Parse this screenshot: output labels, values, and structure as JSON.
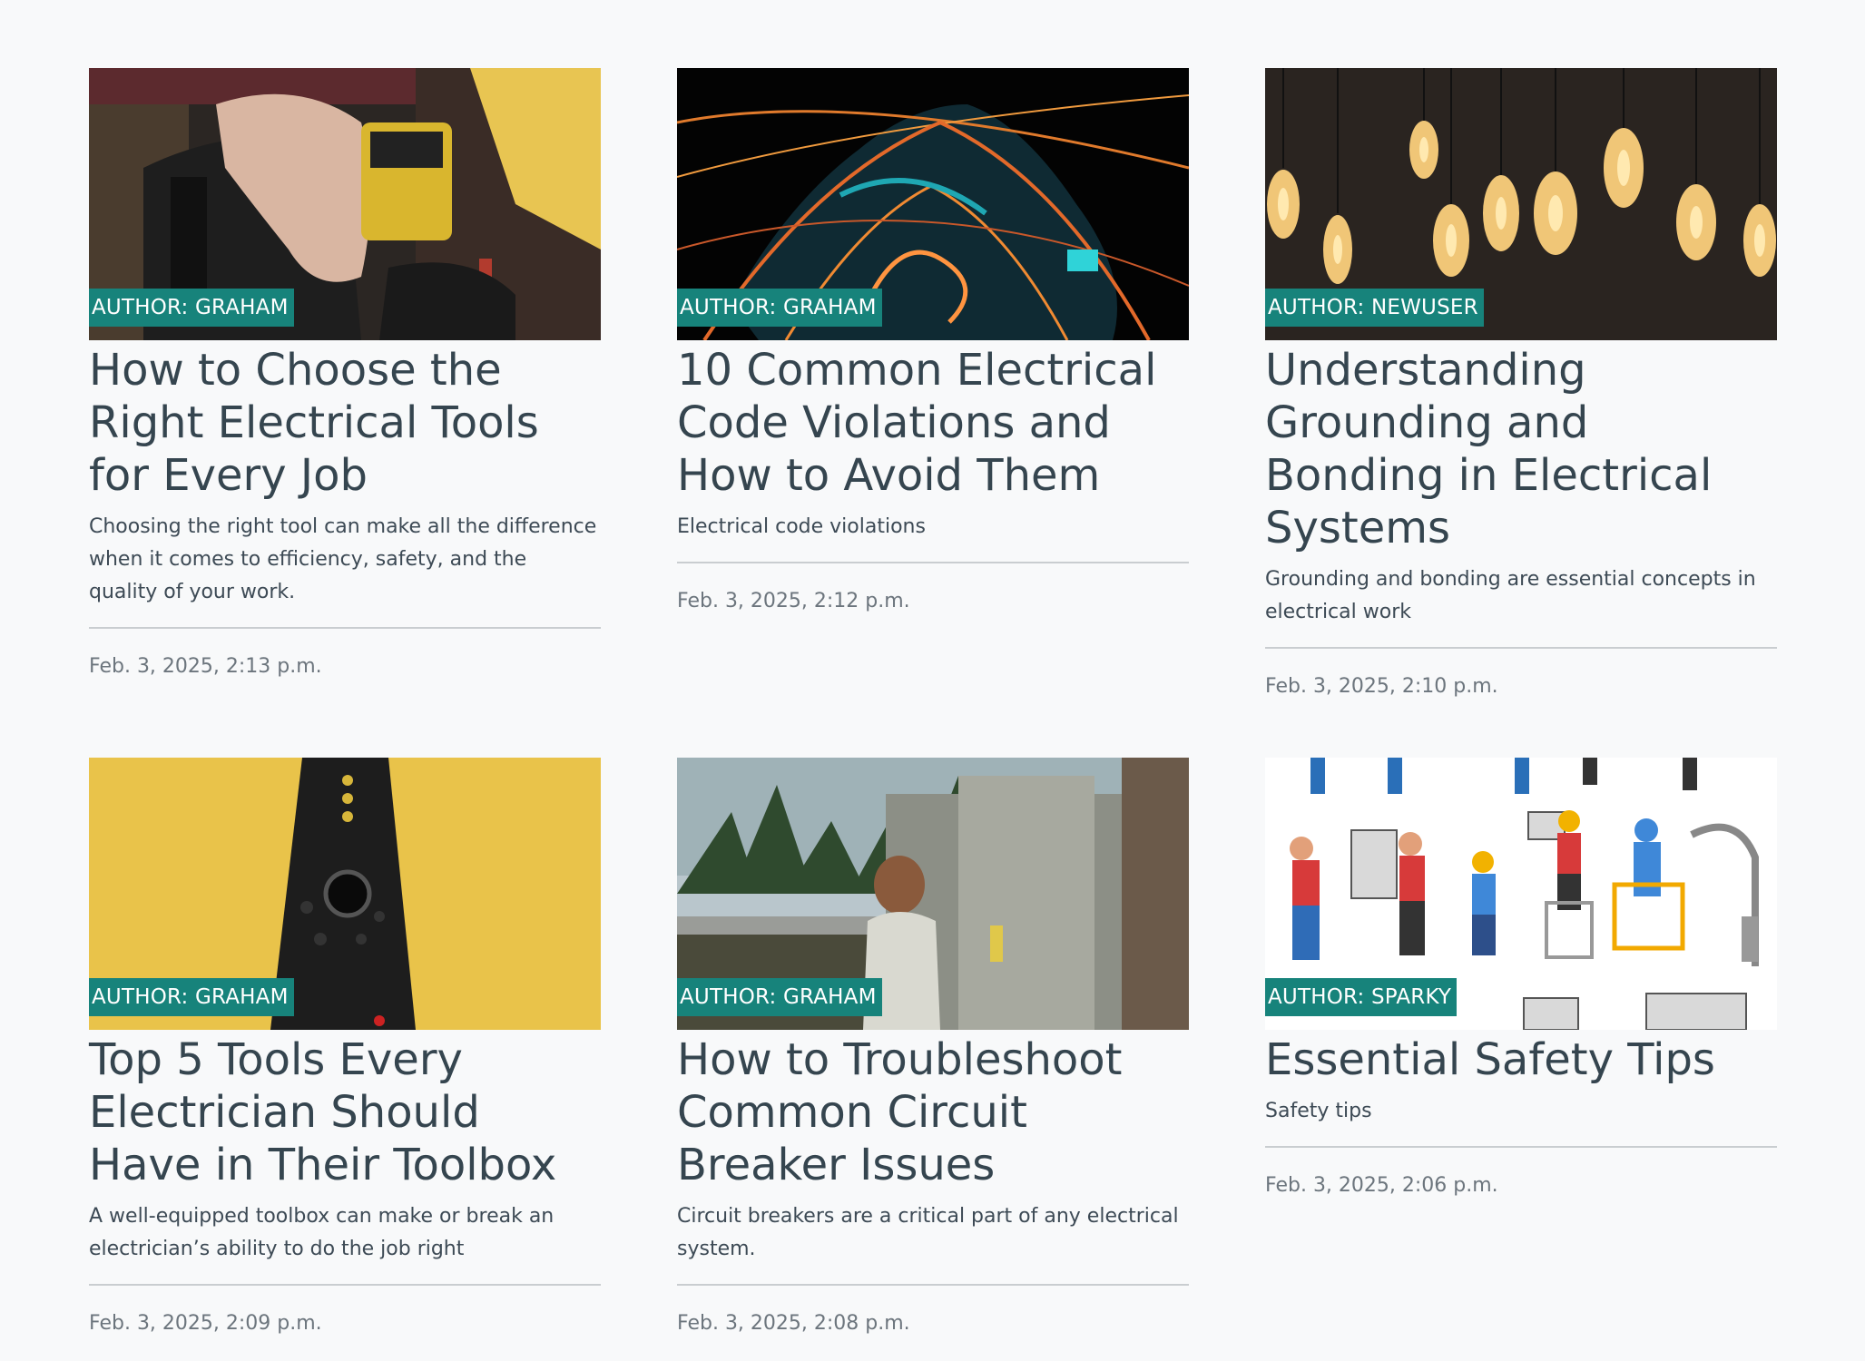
{
  "posts": [
    {
      "image": "electrician-tool-belt-photo",
      "author_label": "AUTHOR: GRAHAM",
      "title": "How to Choose the Right Electrical Tools for Every Job",
      "excerpt": "Choosing the right tool can make all the difference when it comes to efficiency, safety, and the quality of your work.",
      "date": "Feb. 3, 2025, 2:13 p.m."
    },
    {
      "image": "glowing-light-trails-photo",
      "author_label": "AUTHOR: GRAHAM",
      "title": "10 Common Electrical Code Violations and How to Avoid Them",
      "excerpt": "Electrical code violations",
      "date": "Feb. 3, 2025, 2:12 p.m."
    },
    {
      "image": "hanging-edison-bulbs-photo",
      "author_label": "AUTHOR: NEWUSER",
      "title": "Understanding Grounding and Bonding in Electrical Systems",
      "excerpt": "Grounding and bonding are essential concepts in electrical work",
      "date": "Feb. 3, 2025, 2:10 p.m."
    },
    {
      "image": "wire-stripper-yellow-photo",
      "author_label": "AUTHOR: GRAHAM",
      "title": "Top 5 Tools Every Electrician Should Have in Their Toolbox",
      "excerpt": "A well-equipped toolbox can make or break an electrician’s ability to do the job right",
      "date": "Feb. 3, 2025, 2:09 p.m."
    },
    {
      "image": "woman-at-electrical-cabinet-photo",
      "author_label": "AUTHOR: GRAHAM",
      "title": "How to Troubleshoot Common Circuit Breaker Issues",
      "excerpt": "Circuit breakers are a critical part of any electrical system.",
      "date": "Feb. 3, 2025, 2:08 p.m."
    },
    {
      "image": "electrician-workers-illustration",
      "author_label": "AUTHOR: SPARKY",
      "title": "Essential Safety Tips",
      "excerpt": "Safety tips",
      "date": "Feb. 3, 2025, 2:06 p.m."
    }
  ]
}
